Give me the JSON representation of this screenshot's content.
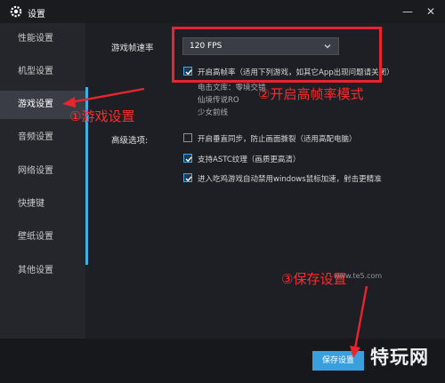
{
  "window": {
    "title": "设置",
    "minimize": "—",
    "close": "✕"
  },
  "sidebar": {
    "items": [
      {
        "label": "性能设置"
      },
      {
        "label": "机型设置"
      },
      {
        "label": "游戏设置"
      },
      {
        "label": "音频设置"
      },
      {
        "label": "网络设置"
      },
      {
        "label": "快捷键"
      },
      {
        "label": "壁纸设置"
      },
      {
        "label": "其他设置"
      }
    ],
    "active": "游戏设置"
  },
  "main": {
    "frame_rate_label": "游戏帧速率",
    "frame_rate_value": "120 FPS",
    "high_fps_option": "开启高帧率（适用下列游戏，如其它App出现问题请关闭）",
    "supported_games": [
      "电击文库：零境交错",
      "仙境传说RO",
      "少女前线"
    ],
    "advanced_label": "高级选项:",
    "advanced_options": [
      {
        "label": "开启垂直同步，防止画面撕裂（适用高配电脑）",
        "checked": false
      },
      {
        "label": "支持ASTC纹理（画质更高清）",
        "checked": true
      },
      {
        "label": "进入吃鸡游戏自动禁用windows鼠标加速，射击更精准",
        "checked": true
      }
    ]
  },
  "footer": {
    "save_label": "保存设置"
  },
  "annotations": {
    "step1": "①游戏设置",
    "step2": "②开启高帧率模式",
    "step3": "③保存设置"
  },
  "watermark": {
    "text": "特玩网",
    "url": "www.te5.com"
  },
  "colors": {
    "accent": "#3aa0dd",
    "annotation": "#e8242e",
    "sidebar_active": "#3a3d45"
  }
}
